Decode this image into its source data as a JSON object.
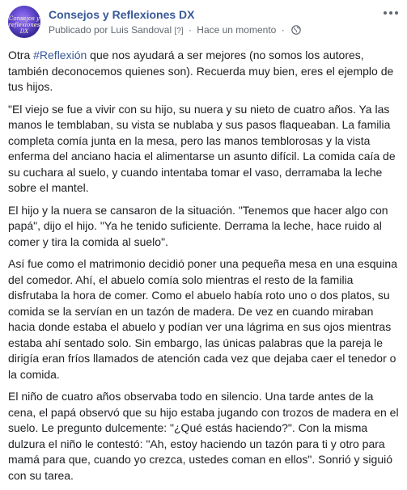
{
  "post": {
    "page_name": "Consejos y Reflexiones DX",
    "avatar_text": "Consejos y reflexiones DX",
    "author_prefix": "Publicado por",
    "author_name": "Luis Sandoval",
    "author_suffix": "[?]",
    "separator": "·",
    "timestamp": "Hace un momento",
    "privacy_icon": "globe-icon",
    "more_icon": "more-options-icon",
    "intro_before": "Otra ",
    "hashtag": "#Reflexión",
    "intro_after": " que nos ayudará a ser mejores (no somos los autores, también deconocemos quienes son). Recuerda muy bien, eres el ejemplo de tus hijos.",
    "paragraphs": [
      "\"El viejo se fue a vivir con su hijo, su nuera y su nieto de cuatro años. Ya las manos le temblaban, su vista se nublaba y sus pasos flaqueaban. La familia completa comía junta en la mesa, pero las manos temblorosas y la vista enferma del anciano hacia el alimentarse un asunto difícil. La comida caía de su cuchara al suelo, y cuando intentaba tomar el vaso, derramaba la leche sobre el mantel.",
      "El hijo y la nuera se cansaron de la situación. \"Tenemos que hacer algo con papá\", dijo el hijo. \"Ya he tenido suficiente. Derrama la leche, hace ruido al comer y tira la comida al suelo\".",
      "Así fue como el matrimonio decidió poner una pequeña mesa en una esquina del comedor. Ahí, el abuelo comía solo mientras el resto de la familia disfrutaba la hora de comer. Como el abuelo había roto uno o dos platos, su comida se la servían en un tazón de madera. De vez en cuando miraban hacia donde estaba el abuelo y podían ver una lágrima en sus ojos mientras estaba ahí sentado solo. Sin embargo, las únicas palabras que la pareja le dirigía eran fríos llamados de atención cada vez que dejaba caer el tenedor o la comida.",
      "El niño de cuatro años observaba todo en silencio. Una tarde antes de la cena, el papá observó que su hijo estaba jugando con trozos de madera en el suelo. Le pregunto dulcemente: \"¿Qué estás haciendo?\". Con la misma dulzura el niño le contestó: \"Ah, estoy haciendo un tazón para ti y otro para mamá para que, cuando yo crezca, ustedes coman en ellos\". Sonrió y siguió con su tarea."
    ]
  },
  "colors": {
    "link": "#385898",
    "text": "#1c1e21",
    "meta": "#606770"
  }
}
